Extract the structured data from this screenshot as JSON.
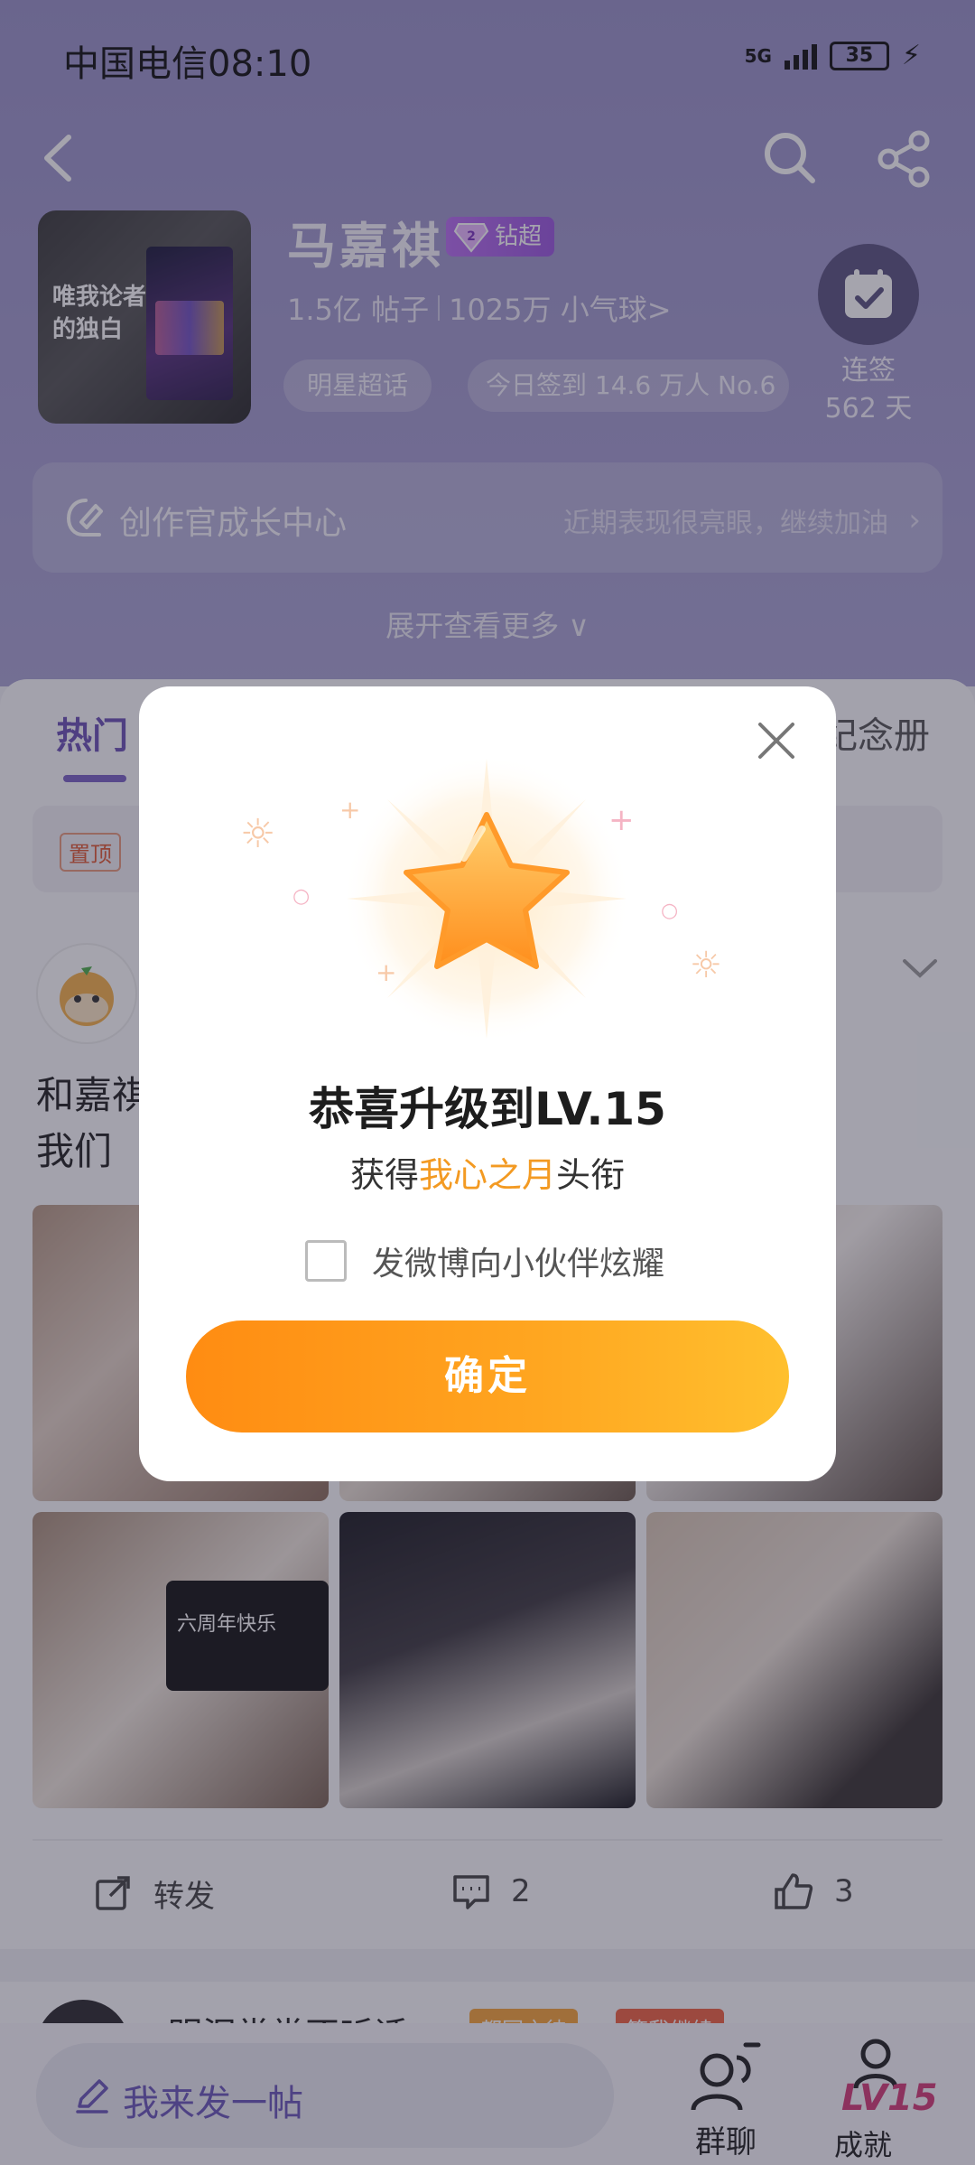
{
  "status_bar": {
    "carrier_time": "中国电信08:10",
    "network": "5G",
    "battery": "35"
  },
  "super_topic": {
    "name": "马嘉祺",
    "badge": "钻超",
    "badge_level": "2",
    "posts": "1.5亿 帖子",
    "followers": "1025万 小气球>",
    "chip_type": "明星超话",
    "chip_checkin": "今日签到 14.6 万人 No.6",
    "checkin_streak": "连签 562 天",
    "cover_text": "唯我论者的独白"
  },
  "creator": {
    "title": "创作官成长中心",
    "hint": "近期表现很亮眼，继续加油"
  },
  "expand_more": "展开查看更多 ∨",
  "tabs": {
    "hot": "热门",
    "album": "纪念册"
  },
  "pinned": {
    "tag": "置顶"
  },
  "post": {
    "text_line1": "和嘉祺",
    "text_line2": "我们",
    "tablet_caption": "六周年快乐",
    "repost": "转发",
    "comments": "2",
    "likes": "3"
  },
  "next_post": {
    "name": "明泪常常不听话",
    "tag1": "都园之徒",
    "tag2": "等我继续"
  },
  "bottom_bar": {
    "compose": "我来发一帖",
    "group_chat": "群聊",
    "level_badge": "LV15",
    "level_label": "成就"
  },
  "dialog": {
    "title": "恭喜升级到LV.15",
    "subtitle_prefix": "获得",
    "subtitle_highlight": "我心之月",
    "subtitle_suffix": "头衔",
    "share_label": "发微博向小伙伴炫耀",
    "confirm": "确定"
  },
  "colors": {
    "header_purple": "#9a93c9",
    "accent_purple": "#6b52b6",
    "confirm_orange": "#ff9a1a",
    "highlight_orange": "#f39a22",
    "star_orange": "#ffa32e"
  }
}
